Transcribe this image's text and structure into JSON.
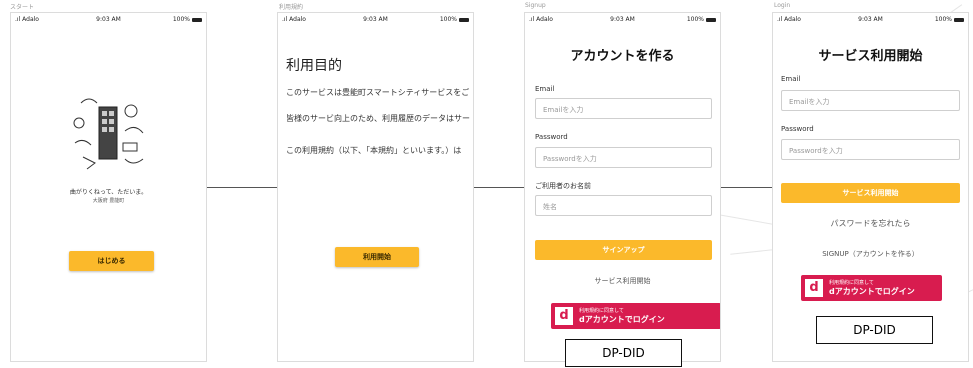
{
  "canvas": {
    "labels": [
      "スタート",
      "利用規約",
      "Signup",
      "Login"
    ]
  },
  "statusbar": {
    "carrier": "Adalo",
    "time": "9:03 AM",
    "battery": "100%"
  },
  "screen1": {
    "illustration_caption": "曲がりくねって、ただいま。",
    "illustration_sub": "大阪府 豊能町",
    "start_button": "はじめる"
  },
  "screen2": {
    "title": "利用目的",
    "para1": "このサービスは豊能町スマートシティサービスをご",
    "para2": "皆様のサービ向上のため、利用履歴のデータはサー",
    "para3": "この利用規約（以下、「本規約」といいます。）は",
    "button": "利用開始"
  },
  "screen3": {
    "title": "アカウントを作る",
    "email_label": "Email",
    "email_placeholder": "Emailを入力",
    "password_label": "Password",
    "password_placeholder": "Passwordを入力",
    "name_label": "ご利用者のお名前",
    "name_placeholder": "姓名",
    "signup_button": "サインアップ",
    "service_link": "サービス利用開始",
    "d_small": "利用規約に同意して",
    "d_main": "dアカウントでログイン",
    "dpdid": "DP-DID"
  },
  "screen4": {
    "title": "サービス利用開始",
    "email_label": "Email",
    "email_placeholder": "Emailを入力",
    "password_label": "Password",
    "password_placeholder": "Passwordを入力",
    "start_button": "サービス利用開始",
    "forgot_link": "パスワードを忘れたら",
    "signup_link": "SIGNUP（アカウントを作る）",
    "d_small": "利用規約に同意して",
    "d_main": "dアカウントでログイン",
    "dpdid": "DP-DID"
  },
  "colors": {
    "accent_yellow": "#fbb92b",
    "d_red": "#d81c4f",
    "border": "#dcdcdc"
  }
}
